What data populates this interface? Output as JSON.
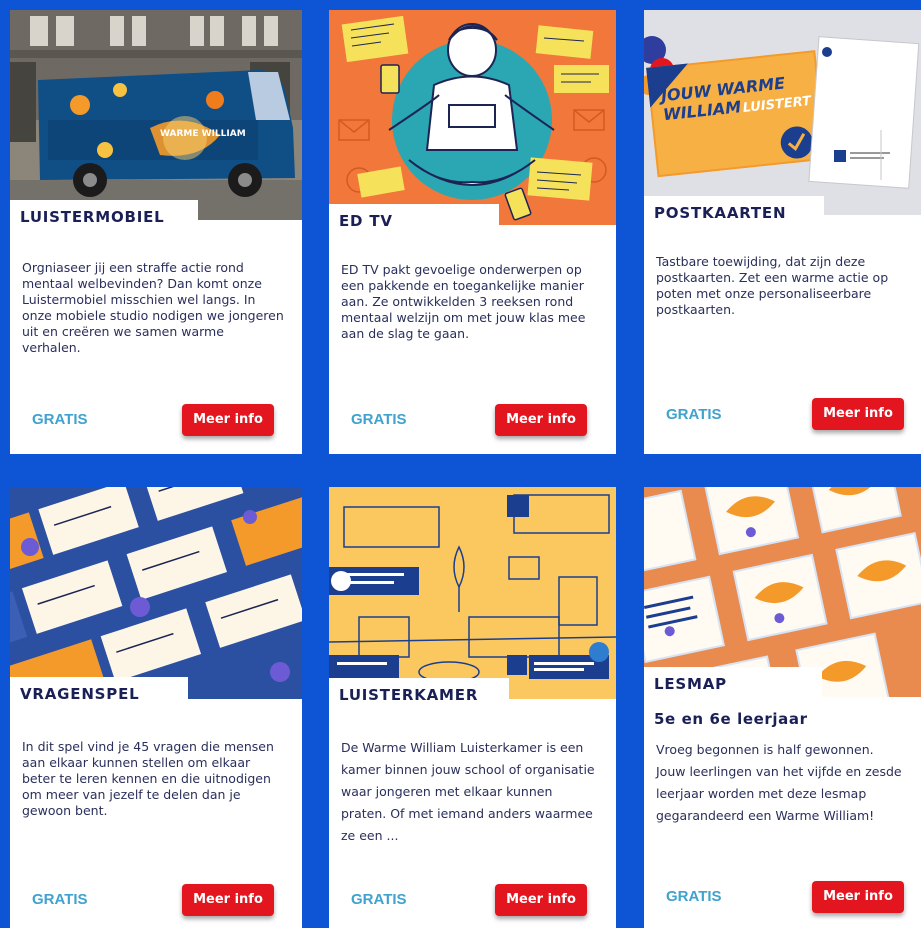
{
  "colors": {
    "background": "#0d55d4",
    "title": "#1a1f56",
    "price": "#3fa2cf",
    "button": "#e3161f"
  },
  "cards": [
    {
      "title": "LUISTERMOBIEL",
      "description": "Orgniaseer jij een straffe actie rond mentaal welbevinden? Dan komt onze Luistermobiel misschien wel langs. In onze mobiele studio nodigen we jongeren uit en creëren we samen warme verhalen.",
      "price": "GRATIS",
      "button": "Meer info",
      "image_text": "WARME WILLIAM"
    },
    {
      "title": "ED TV",
      "description": "ED TV pakt gevoelige onderwerpen op een pakkende en toegankelijke manier aan. Ze ontwikkelden 3 reeksen rond mentaal welzijn om met jouw klas mee aan de slag te gaan.",
      "price": "GRATIS",
      "button": "Meer info"
    },
    {
      "title": "POSTKAARTEN",
      "description": "Tastbare toewijding, dat zijn deze postkaarten. Zet een warme actie op poten met onze personaliseerbare postkaarten.",
      "price": "GRATIS",
      "button": "Meer info",
      "image_text_1": "JOUW WARME",
      "image_text_2": "WILLIAM",
      "image_text_3": "LUISTERT"
    },
    {
      "title": "VRAGENSPEL",
      "description": "In dit spel vind je 45 vragen die mensen aan elkaar kunnen stellen om elkaar beter te leren kennen en die uitnodigen om meer van jezelf te delen dan je gewoon bent.",
      "price": "GRATIS",
      "button": "Meer info"
    },
    {
      "title": "LUISTERKAMER",
      "description": "De Warme William Luisterkamer is een kamer binnen jouw school of organisatie waar jongeren met elkaar kunnen praten. Of met iemand anders waarmee ze een ...",
      "price": "GRATIS",
      "button": "Meer info"
    },
    {
      "title": "LESMAP",
      "subtitle": "5e en 6e leerjaar",
      "description": "Vroeg begonnen is half gewonnen. Jouw leerlingen van het vijfde en zesde leerjaar worden met deze lesmap gegarandeerd een Warme William!",
      "price": "GRATIS",
      "button": "Meer info"
    }
  ]
}
